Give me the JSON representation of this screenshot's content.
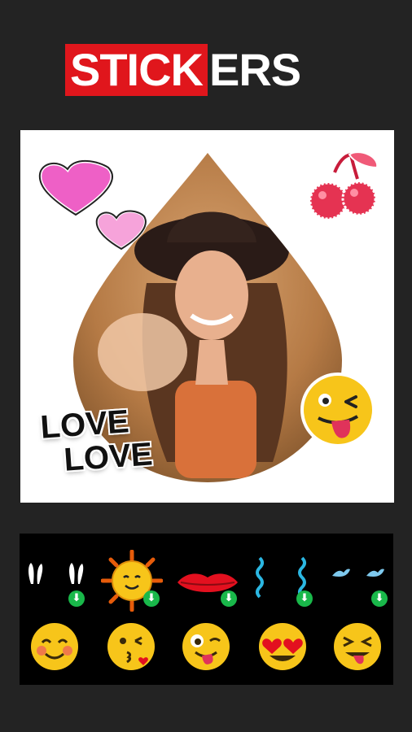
{
  "header": {
    "title_part_red": "STICK",
    "title_part_white": "ERS"
  },
  "canvas": {
    "love_line_1": "LOVE",
    "love_line_2": "LOVE"
  },
  "tray": {
    "row1": [
      "bunny-ears-sticker",
      "bunny-ears-sticker-download",
      "sun-sticker",
      "lips-sticker",
      "wave-line-sticker",
      "wave-line-sticker-download",
      "bird-sticker",
      "bird-sticker-download"
    ],
    "row2": [
      "smiling-blush-emoji",
      "kissing-emoji",
      "winking-tongue-emoji",
      "heart-eyes-emoji",
      "squinting-tongue-emoji"
    ]
  },
  "colors": {
    "background": "#232323",
    "accent_red": "#e0161c",
    "download_green": "#19b84a",
    "emoji_yellow": "#f7c51a"
  }
}
